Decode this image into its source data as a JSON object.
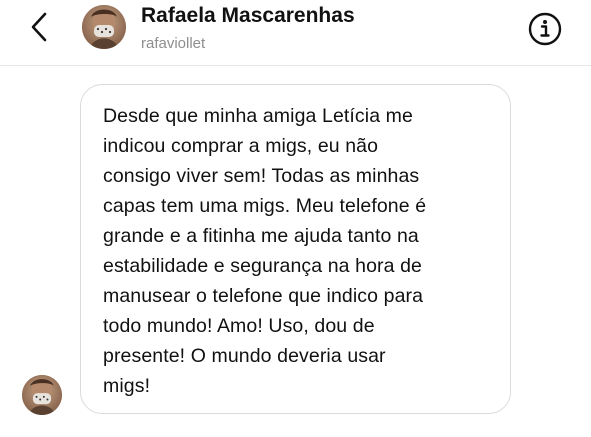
{
  "header": {
    "back_icon": "chevron-left-icon",
    "contact_name": "Rafaela Mascarenhas",
    "username": "rafaviollet",
    "info_icon": "info-circle-icon"
  },
  "message": {
    "lines": [
      "Desde que minha amiga Letícia me",
      "indicou comprar a migs, eu não",
      "consigo viver sem! Todas as minhas",
      "capas tem uma migs. Meu telefone é",
      "grande e a fitinha me ajuda tanto na",
      "estabilidade e segurança na hora de",
      "manusear o telefone que indico para",
      "todo mundo! Amo! Uso, dou de",
      "presente! O mundo deveria usar",
      "migs!"
    ]
  },
  "colors": {
    "text": "#111111",
    "muted": "#8e8e8e",
    "border": "#dbdbdb",
    "divider": "#e6e6e6"
  }
}
